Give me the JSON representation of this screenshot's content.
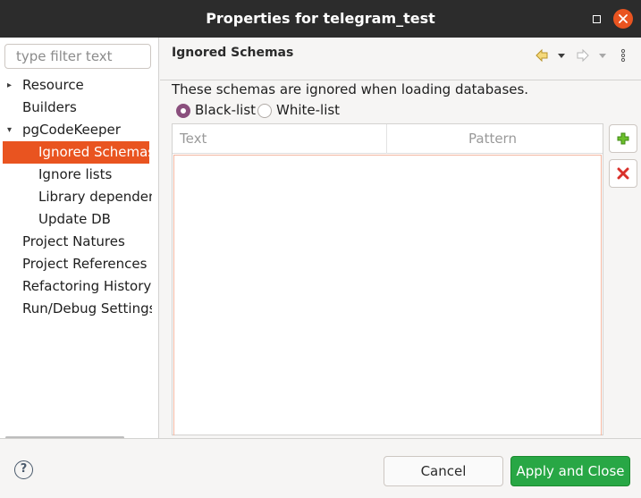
{
  "window": {
    "title": "Properties for telegram_test",
    "minimize_icon": "minimize-icon",
    "close_icon": "close-icon",
    "accent": "#e95420"
  },
  "sidebar": {
    "filter_placeholder": "type filter text",
    "items": [
      {
        "label": "Resource",
        "expander": "collapsed"
      },
      {
        "label": "Builders"
      },
      {
        "label": "pgCodeKeeper",
        "expander": "expanded"
      },
      {
        "label": "Ignored Schemas",
        "selected": true
      },
      {
        "label": "Ignore lists"
      },
      {
        "label": "Library dependencies"
      },
      {
        "label": "Update DB"
      },
      {
        "label": "Project Natures"
      },
      {
        "label": "Project References"
      },
      {
        "label": "Refactoring History"
      },
      {
        "label": "Run/Debug Settings"
      }
    ]
  },
  "page": {
    "heading": "Ignored Schemas",
    "description": "These schemas are ignored when loading databases.",
    "radio_blacklist": "Black-list",
    "radio_whitelist": "White-list",
    "selected_mode": "Black-list",
    "table": {
      "columns": [
        "Text",
        "Pattern"
      ],
      "rows": []
    },
    "nav_icons": [
      "back-arrow-icon",
      "back-menu-icon",
      "forward-arrow-icon",
      "forward-menu-icon",
      "more-icon"
    ],
    "side_buttons": [
      "add-icon",
      "remove-icon"
    ]
  },
  "footer": {
    "help_label": "?",
    "cancel_label": "Cancel",
    "apply_label": "Apply and Close",
    "apply_color": "#28a745"
  }
}
